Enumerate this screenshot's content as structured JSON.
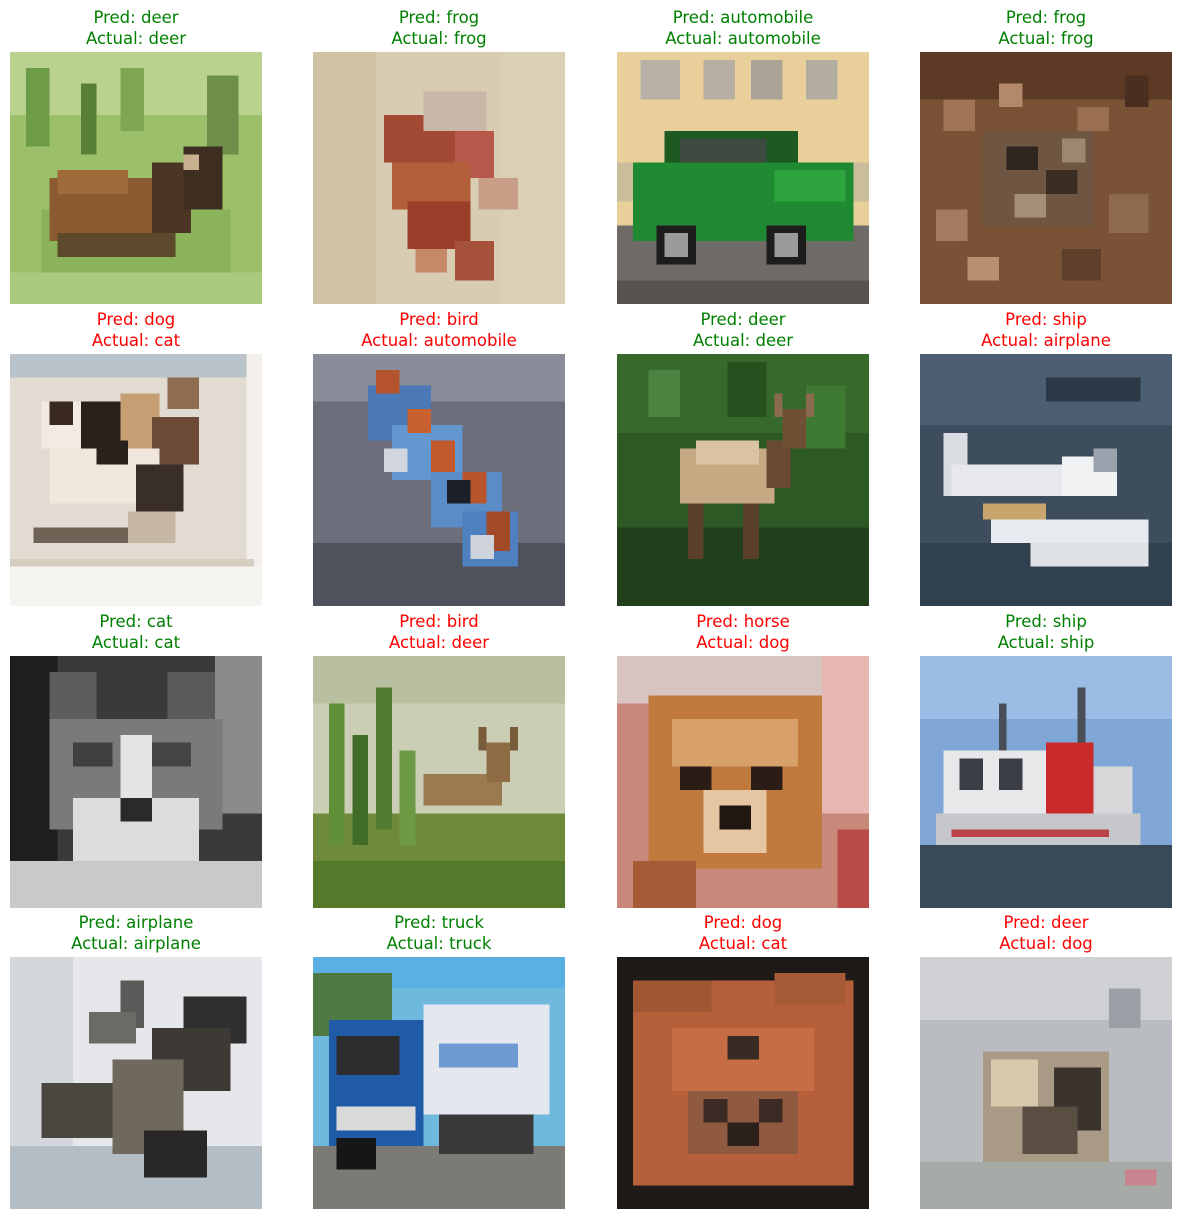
{
  "colors": {
    "correct": "#008000",
    "wrong": "#ff0000"
  },
  "prefixes": {
    "pred": "Pred: ",
    "actual": "Actual: "
  },
  "panels": [
    {
      "pred": "deer",
      "actual": "deer",
      "scene": "deer in green grass"
    },
    {
      "pred": "frog",
      "actual": "frog",
      "scene": "reddish frog on pale background"
    },
    {
      "pred": "automobile",
      "actual": "automobile",
      "scene": "green car in front of yellow building"
    },
    {
      "pred": "frog",
      "actual": "frog",
      "scene": "camouflaged brown frog"
    },
    {
      "pred": "dog",
      "actual": "cat",
      "scene": "calico cat on light background"
    },
    {
      "pred": "bird",
      "actual": "automobile",
      "scene": "blue toy car with orange stripe"
    },
    {
      "pred": "deer",
      "actual": "deer",
      "scene": "elk in dark green forest"
    },
    {
      "pred": "ship",
      "actual": "airplane",
      "scene": "white seaplane over dark water"
    },
    {
      "pred": "cat",
      "actual": "cat",
      "scene": "grayscale cat face"
    },
    {
      "pred": "bird",
      "actual": "deer",
      "scene": "deer in tall grass"
    },
    {
      "pred": "horse",
      "actual": "dog",
      "scene": "fluffy orange dog"
    },
    {
      "pred": "ship",
      "actual": "ship",
      "scene": "white and red boat"
    },
    {
      "pred": "airplane",
      "actual": "airplane",
      "scene": "dark jet against pale sky"
    },
    {
      "pred": "truck",
      "actual": "truck",
      "scene": "blue and white tanker truck"
    },
    {
      "pred": "dog",
      "actual": "cat",
      "scene": "orange cat face with dark border"
    },
    {
      "pred": "deer",
      "actual": "dog",
      "scene": "small dog on gray background"
    }
  ]
}
